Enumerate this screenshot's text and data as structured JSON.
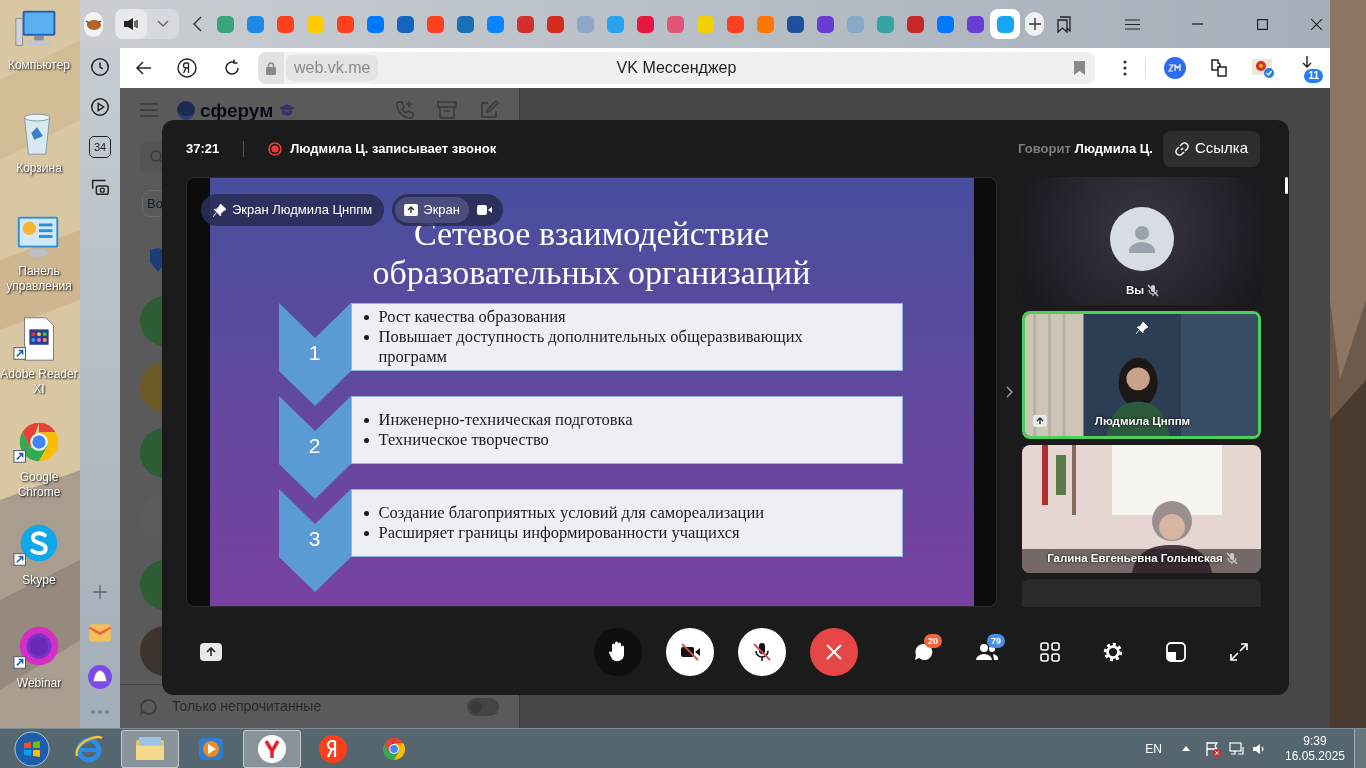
{
  "desktop_icons": [
    {
      "label": "Компьютер",
      "kind": "computer",
      "shortcut": false
    },
    {
      "label": "Корзина",
      "kind": "trash",
      "shortcut": false
    },
    {
      "label": "Панель управления",
      "kind": "control-panel",
      "shortcut": false
    },
    {
      "label": "Adobe Reader XI",
      "kind": "document",
      "shortcut": true
    },
    {
      "label": "Google Chrome",
      "kind": "chrome",
      "shortcut": true
    },
    {
      "label": "Skype",
      "kind": "skype",
      "shortcut": true
    },
    {
      "label": "Webinar",
      "kind": "webinar",
      "shortcut": true
    }
  ],
  "browser": {
    "tabs": [
      {
        "selected": false,
        "color": "#3aa57a"
      },
      {
        "selected": false,
        "color": "#1e88e5"
      },
      {
        "selected": false,
        "color": "#fc3f1d"
      },
      {
        "selected": false,
        "color": "#ffcc00"
      },
      {
        "selected": false,
        "color": "#fc3f1d"
      },
      {
        "selected": false,
        "color": "#0077ff"
      },
      {
        "selected": false,
        "color": "#1565c0"
      },
      {
        "selected": false,
        "color": "#fc3f1d"
      },
      {
        "selected": false,
        "color": "#1a6fb5"
      },
      {
        "selected": false,
        "color": "#0a84ff"
      },
      {
        "selected": false,
        "color": "#d32f2f"
      },
      {
        "selected": false,
        "color": "#d52b1e"
      },
      {
        "selected": false,
        "color": "#8fa7c8"
      },
      {
        "selected": false,
        "color": "#29a3f0"
      },
      {
        "selected": false,
        "color": "#e5173f"
      },
      {
        "selected": false,
        "color": "#e25575"
      },
      {
        "selected": false,
        "color": "#f5d000"
      },
      {
        "selected": false,
        "color": "#fc3f1d"
      },
      {
        "selected": false,
        "color": "#ff7700"
      },
      {
        "selected": false,
        "color": "#2050a0"
      },
      {
        "selected": false,
        "color": "#6a3cd6"
      },
      {
        "selected": false,
        "color": "#8aa8c8"
      },
      {
        "selected": false,
        "color": "#38a3a5"
      },
      {
        "selected": false,
        "color": "#c62828"
      },
      {
        "selected": false,
        "color": "#0077ff"
      },
      {
        "selected": false,
        "color": "#6a3cd6"
      },
      {
        "selected": true,
        "color": "#19a6f5"
      }
    ],
    "url": "web.vk.me",
    "page_title": "VK Мессенджер",
    "downloads_badge": "11",
    "side_panel_top": [
      {
        "kind": "history"
      },
      {
        "kind": "player"
      },
      {
        "kind": "counter",
        "label": "34"
      },
      {
        "kind": "screenshot"
      }
    ],
    "side_panel_bottom": [
      {
        "kind": "add"
      },
      {
        "kind": "mail"
      },
      {
        "kind": "assistant"
      },
      {
        "kind": "more"
      }
    ]
  },
  "messenger": {
    "logo": "сферум",
    "folder_chip": "Во",
    "chats": [
      {
        "color": "#2f5d34"
      },
      {
        "color": "#6b5a26"
      },
      {
        "color": "#2f5d34"
      },
      {
        "color": "#5c5c5c"
      },
      {
        "color": "#2f5d34"
      },
      {
        "color": "#3d342e"
      }
    ],
    "unread_filter": {
      "label": "Только непрочитанные",
      "on": false
    }
  },
  "call": {
    "timer": "37:21",
    "recording": "Людмила Ц. записывает звонок",
    "speaker_label": "Говорит",
    "speaker_name": "Людмила Ц.",
    "link_button": "Ссылка",
    "stage": {
      "pin_label": "Экран Людмила Цнппм",
      "views": [
        {
          "kind": "screen",
          "label": "Экран",
          "selected": true
        },
        {
          "kind": "camera",
          "selected": false
        }
      ],
      "slide": {
        "title_lines": [
          "Сетевое взаимодействие",
          "образовательных организаций"
        ],
        "items": [
          {
            "number": "1",
            "bullets": [
              "Рост качества образования",
              "Повышает доступность дополнительных общеразвивающих программ"
            ]
          },
          {
            "number": "2",
            "bullets": [
              "Инженерно-техническая подготовка",
              "Техническое творчество"
            ]
          },
          {
            "number": "3",
            "bullets": [
              "Создание благоприятных условий для самореализации",
              "Расширяет границы информированности учащихся"
            ]
          }
        ]
      }
    },
    "participants": [
      {
        "kind": "avatar",
        "name": "Вы",
        "muted": true,
        "selected": false,
        "pinned": false,
        "sharing": false
      },
      {
        "kind": "video",
        "name": "Людмила Цнппм",
        "muted": false,
        "selected": true,
        "pinned": true,
        "sharing": true
      },
      {
        "kind": "room",
        "name": "Галина Евгеньевна Голынская",
        "muted": true,
        "selected": false,
        "pinned": false,
        "sharing": false
      },
      {
        "kind": "dark"
      }
    ],
    "controls": [
      {
        "kind": "hand"
      },
      {
        "kind": "camera",
        "on": false
      },
      {
        "kind": "mic",
        "on": false
      },
      {
        "kind": "hangup"
      }
    ],
    "tools": [
      {
        "kind": "chat",
        "badge": "20"
      },
      {
        "kind": "people",
        "badge": "79"
      },
      {
        "kind": "grid"
      },
      {
        "kind": "settings"
      },
      {
        "kind": "layout"
      },
      {
        "kind": "fullscreen"
      }
    ]
  },
  "taskbar": {
    "apps": [
      {
        "kind": "ie",
        "selected": false
      },
      {
        "kind": "explorer",
        "selected": true
      },
      {
        "kind": "media",
        "selected": false
      },
      {
        "kind": "yandex-browser",
        "selected": true
      },
      {
        "kind": "yandex",
        "selected": false
      },
      {
        "kind": "chrome",
        "selected": false
      }
    ],
    "language": "EN",
    "time": "9:39",
    "date": "16.05.2025"
  }
}
